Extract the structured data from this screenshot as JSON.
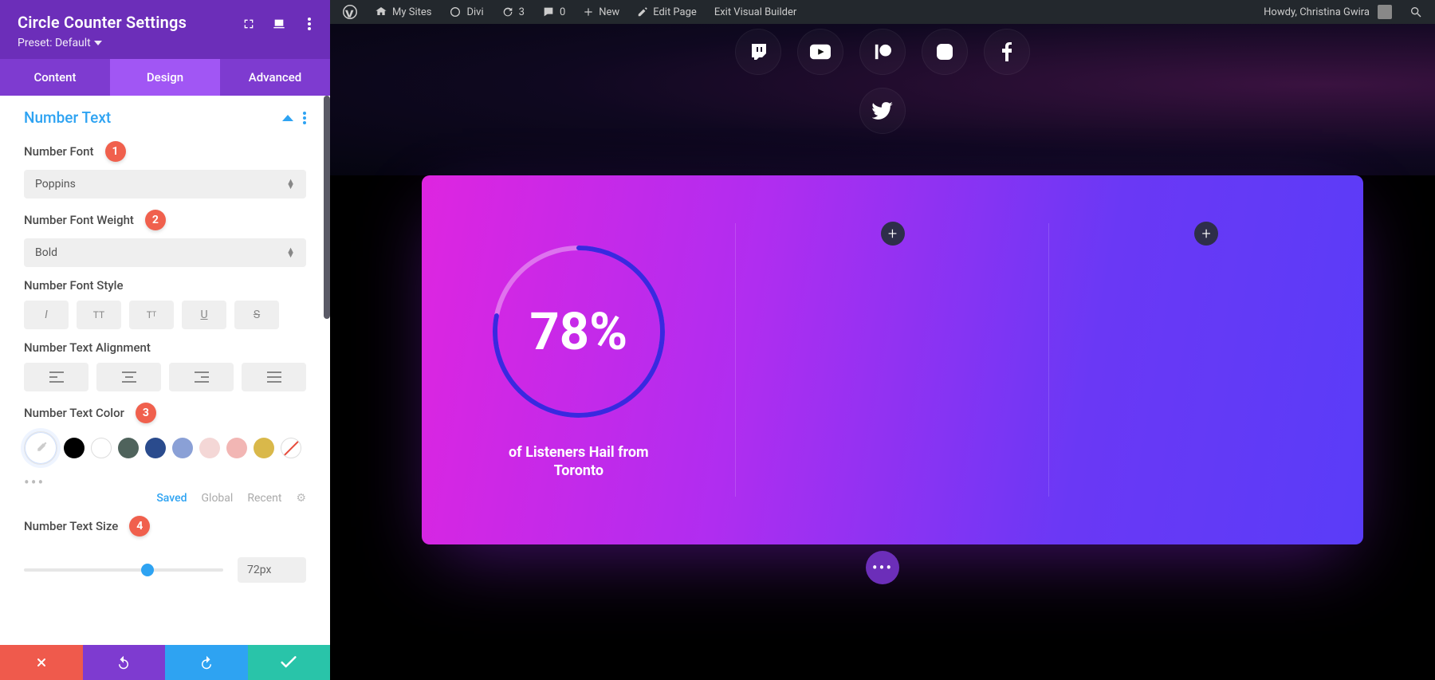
{
  "sidebar": {
    "title": "Circle Counter Settings",
    "preset": "Preset: Default",
    "tabs": [
      "Content",
      "Design",
      "Advanced"
    ],
    "active_tab": 1,
    "section_title": "Number Text",
    "fields": {
      "font_label": "Number Font",
      "font_value": "Poppins",
      "weight_label": "Number Font Weight",
      "weight_value": "Bold",
      "style_label": "Number Font Style",
      "align_label": "Number Text Alignment",
      "color_label": "Number Text Color",
      "size_label": "Number Text Size",
      "size_value": "72px"
    },
    "color_tabs": {
      "saved": "Saved",
      "global": "Global",
      "recent": "Recent"
    },
    "swatches": [
      "#000000",
      "#ffffff",
      "#4f635c",
      "#2a4b8d",
      "#8aa0d6",
      "#f4d7d6",
      "#f2b6b4",
      "#d9b84a"
    ],
    "badges": {
      "font": "1",
      "weight": "2",
      "color": "3",
      "size": "4"
    },
    "slider_pct": 62
  },
  "wp_bar": {
    "my_sites": "My Sites",
    "divi": "Divi",
    "updates": "3",
    "comments": "0",
    "new": "New",
    "edit_page": "Edit Page",
    "exit_vb": "Exit Visual Builder",
    "howdy": "Howdy, Christina Gwira"
  },
  "preview": {
    "counter_value": "78",
    "counter_suffix": "%",
    "counter_pct": 78,
    "caption": "of Listeners Hail from Toronto"
  }
}
